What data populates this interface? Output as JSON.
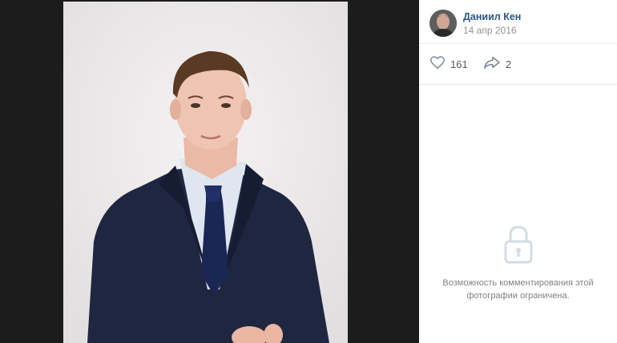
{
  "post": {
    "author_name": "Даниил Кен",
    "date": "14 апр 2016"
  },
  "actions": {
    "likes_count": "161",
    "shares_count": "2"
  },
  "comments": {
    "restricted_notice": "Возможность комментирования этой фотографии ограничена."
  },
  "colors": {
    "link_blue": "#2a5885",
    "viewer_bg": "#1c1c1c",
    "icon_gray": "#828a99"
  },
  "icons": {
    "like": "heart-icon",
    "share": "share-arrow-icon",
    "lock": "lock-icon"
  }
}
